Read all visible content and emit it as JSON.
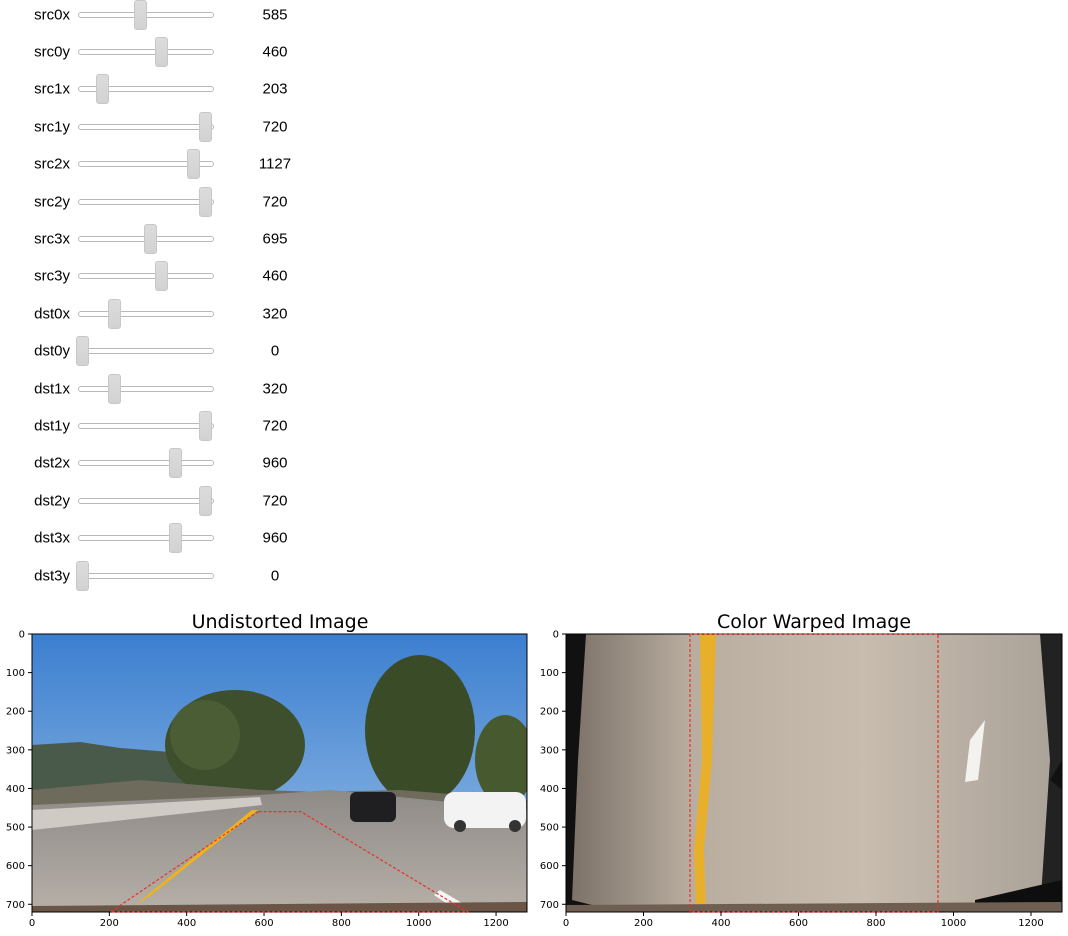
{
  "sliders": [
    {
      "label": "src0x",
      "value": 585,
      "fraction": 0.457
    },
    {
      "label": "src0y",
      "value": 460,
      "fraction": 0.628
    },
    {
      "label": "src1x",
      "value": 203,
      "fraction": 0.16
    },
    {
      "label": "src1y",
      "value": 720,
      "fraction": 0.98
    },
    {
      "label": "src2x",
      "value": 1127,
      "fraction": 0.88
    },
    {
      "label": "src2y",
      "value": 720,
      "fraction": 0.98
    },
    {
      "label": "src3x",
      "value": 695,
      "fraction": 0.54
    },
    {
      "label": "src3y",
      "value": 460,
      "fraction": 0.628
    },
    {
      "label": "dst0x",
      "value": 320,
      "fraction": 0.25
    },
    {
      "label": "dst0y",
      "value": 0,
      "fraction": 0.0
    },
    {
      "label": "dst1x",
      "value": 320,
      "fraction": 0.25
    },
    {
      "label": "dst1y",
      "value": 720,
      "fraction": 0.98
    },
    {
      "label": "dst2x",
      "value": 960,
      "fraction": 0.74
    },
    {
      "label": "dst2y",
      "value": 720,
      "fraction": 0.98
    },
    {
      "label": "dst3x",
      "value": 960,
      "fraction": 0.74
    },
    {
      "label": "dst3y",
      "value": 0,
      "fraction": 0.0
    }
  ],
  "plots": [
    {
      "title": "Undistorted Image",
      "x_ticks": [
        "0",
        "200",
        "400",
        "600",
        "800",
        "1000",
        "1200"
      ],
      "y_ticks": [
        "0",
        "100",
        "200",
        "300",
        "400",
        "500",
        "600",
        "700"
      ],
      "xlim": [
        0,
        1280
      ],
      "ylim": [
        0,
        720
      ],
      "polygon": [
        [
          585,
          460
        ],
        [
          203,
          720
        ],
        [
          1127,
          720
        ],
        [
          695,
          460
        ]
      ],
      "polygon_color": "#e8302a"
    },
    {
      "title": "Color Warped Image",
      "x_ticks": [
        "0",
        "200",
        "400",
        "600",
        "800",
        "1000",
        "1200"
      ],
      "y_ticks": [
        "0",
        "100",
        "200",
        "300",
        "400",
        "500",
        "600",
        "700"
      ],
      "xlim": [
        0,
        1280
      ],
      "ylim": [
        0,
        720
      ],
      "polygon": [
        [
          320,
          0
        ],
        [
          320,
          720
        ],
        [
          960,
          720
        ],
        [
          960,
          0
        ]
      ],
      "polygon_color": "#e8302a"
    }
  ]
}
